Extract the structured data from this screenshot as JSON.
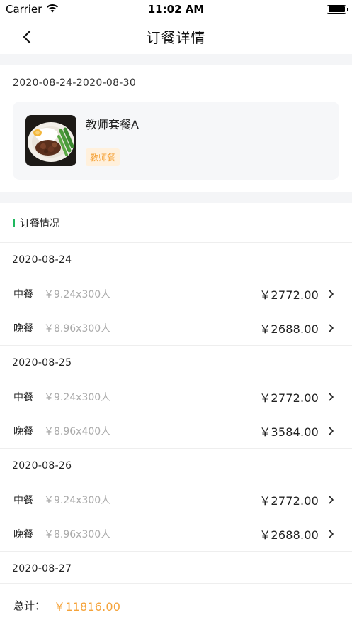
{
  "status": {
    "carrier": "Carrier",
    "time": "11:02 AM"
  },
  "nav": {
    "title": "订餐详情"
  },
  "period": "2020-08-24-2020-08-30",
  "meal": {
    "name": "教师套餐A",
    "tag": "教师餐"
  },
  "section": {
    "title": "订餐情况"
  },
  "days": [
    {
      "date": "2020-08-24",
      "rows": [
        {
          "type": "中餐",
          "calc": "￥9.24x300人",
          "amount": "￥2772.00"
        },
        {
          "type": "晚餐",
          "calc": "￥8.96x300人",
          "amount": "￥2688.00"
        }
      ]
    },
    {
      "date": "2020-08-25",
      "rows": [
        {
          "type": "中餐",
          "calc": "￥9.24x300人",
          "amount": "￥2772.00"
        },
        {
          "type": "晚餐",
          "calc": "￥8.96x400人",
          "amount": "￥3584.00"
        }
      ]
    },
    {
      "date": "2020-08-26",
      "rows": [
        {
          "type": "中餐",
          "calc": "￥9.24x300人",
          "amount": "￥2772.00"
        },
        {
          "type": "晚餐",
          "calc": "￥8.96x300人",
          "amount": "￥2688.00"
        }
      ]
    },
    {
      "date": "2020-08-27",
      "rows": []
    }
  ],
  "footer": {
    "label": "总计：",
    "total": "￥11816.00"
  },
  "colors": {
    "accent": "#f5a33a",
    "green": "#1fb85e",
    "tag_bg": "#fff0dc"
  }
}
